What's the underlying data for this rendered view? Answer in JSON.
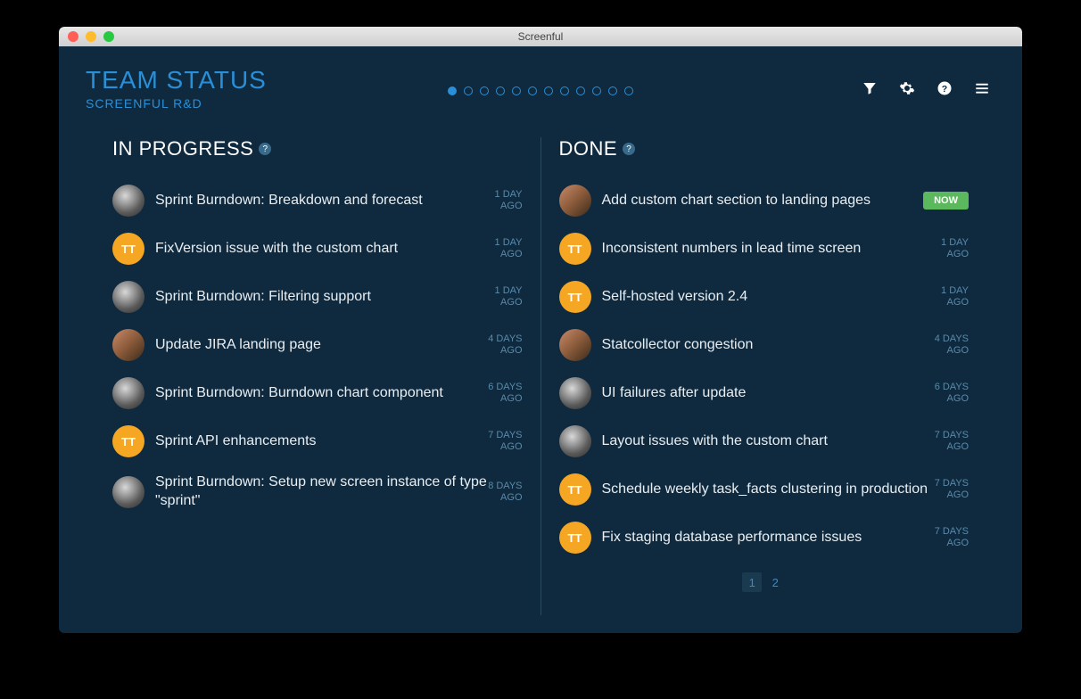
{
  "window": {
    "title": "Screenful"
  },
  "header": {
    "title": "TEAM STATUS",
    "subtitle": "SCREENFUL R&D",
    "pager_total": 12,
    "pager_active": 0
  },
  "columns": {
    "in_progress": {
      "title": "IN PROGRESS",
      "items": [
        {
          "avatar": "photo1",
          "title": "Sprint Burndown: Breakdown and forecast",
          "time": "1 DAY\nAGO"
        },
        {
          "avatar": "initials",
          "initials": "TT",
          "title": "FixVersion issue with the custom chart",
          "time": "1 DAY\nAGO"
        },
        {
          "avatar": "photo1",
          "title": "Sprint Burndown: Filtering support",
          "time": "1 DAY\nAGO"
        },
        {
          "avatar": "photo2",
          "title": "Update JIRA landing page",
          "time": "4 DAYS\nAGO"
        },
        {
          "avatar": "photo1",
          "title": "Sprint Burndown: Burndown chart component",
          "time": "6 DAYS\nAGO"
        },
        {
          "avatar": "initials",
          "initials": "TT",
          "title": "Sprint API enhancements",
          "time": "7 DAYS\nAGO"
        },
        {
          "avatar": "photo1",
          "title": "Sprint Burndown: Setup new screen instance of type \"sprint\"",
          "time": "8 DAYS\nAGO"
        }
      ]
    },
    "done": {
      "title": "DONE",
      "items": [
        {
          "avatar": "photo2",
          "title": "Add custom chart section to landing pages",
          "badge": "NOW"
        },
        {
          "avatar": "initials",
          "initials": "TT",
          "title": "Inconsistent numbers in lead time screen",
          "time": "1 DAY\nAGO"
        },
        {
          "avatar": "initials",
          "initials": "TT",
          "title": "Self-hosted version 2.4",
          "time": "1 DAY\nAGO"
        },
        {
          "avatar": "photo2",
          "title": "Statcollector congestion",
          "time": "4 DAYS\nAGO"
        },
        {
          "avatar": "photo1",
          "title": "UI failures after update",
          "time": "6 DAYS\nAGO"
        },
        {
          "avatar": "photo1",
          "title": "Layout issues with the custom chart",
          "time": "7 DAYS\nAGO"
        },
        {
          "avatar": "initials",
          "initials": "TT",
          "title": "Schedule weekly task_facts clustering in production",
          "time": "7 DAYS\nAGO"
        },
        {
          "avatar": "initials",
          "initials": "TT",
          "title": "Fix staging database performance issues",
          "time": "7 DAYS\nAGO"
        }
      ],
      "pages": [
        "1",
        "2"
      ],
      "active_page": 0
    }
  }
}
